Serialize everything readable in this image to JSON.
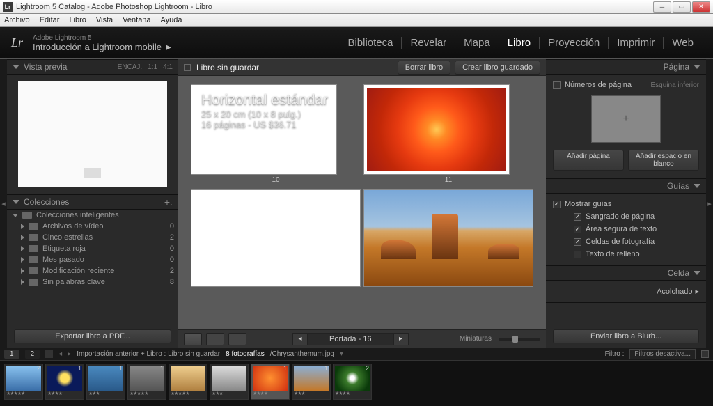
{
  "titlebar": {
    "text": "Lightroom 5 Catalog - Adobe Photoshop Lightroom - Libro",
    "icon": "Lr"
  },
  "menubar": [
    "Archivo",
    "Editar",
    "Libro",
    "Vista",
    "Ventana",
    "Ayuda"
  ],
  "header": {
    "product": "Adobe Lightroom 5",
    "subtitle": "Introducción a Lightroom mobile  ►",
    "modules": [
      "Biblioteca",
      "Revelar",
      "Mapa",
      "Libro",
      "Proyección",
      "Imprimir",
      "Web"
    ],
    "active_module": "Libro"
  },
  "left": {
    "preview": {
      "title": "Vista previa",
      "extras": [
        "ENCAJ.",
        "1:1",
        "4:1"
      ]
    },
    "collections": {
      "title": "Colecciones",
      "group": "Colecciones inteligentes",
      "items": [
        {
          "name": "Archivos de vídeo",
          "count": 0
        },
        {
          "name": "Cinco estrellas",
          "count": 2
        },
        {
          "name": "Etiqueta roja",
          "count": 0
        },
        {
          "name": "Mes pasado",
          "count": 0
        },
        {
          "name": "Modificación reciente",
          "count": 2
        },
        {
          "name": "Sin palabras clave",
          "count": 8
        }
      ]
    },
    "export_btn": "Exportar libro a PDF..."
  },
  "center": {
    "title": "Libro sin guardar",
    "btn_clear": "Borrar libro",
    "btn_create": "Crear libro guardado",
    "overlay": {
      "title": "Horizontal estándar",
      "size": "25 x 20 cm (10 x 8 pulg.)",
      "info": "16 páginas - US $36.71"
    },
    "page_nums": [
      "10",
      "11"
    ],
    "pager": "Portada - 16",
    "thumbs_label": "Miniaturas"
  },
  "right": {
    "pagina": {
      "title": "Página",
      "pagenums": "Números de página",
      "corner": "Esquina inferior",
      "add_page": "Añadir página",
      "add_blank": "Añadir espacio en blanco"
    },
    "guias": {
      "title": "Guías",
      "show": "Mostrar guías",
      "items": [
        "Sangrado de página",
        "Área segura de texto",
        "Celdas de fotografía",
        "Texto de relleno"
      ],
      "checked": [
        true,
        true,
        true,
        false
      ]
    },
    "celda": {
      "title": "Celda",
      "padding": "Acolchado"
    },
    "send_btn": "Enviar libro a Blurb..."
  },
  "filmstrip": {
    "path": "Importación anterior  +  Libro : Libro sin guardar",
    "count": "8 fotografías",
    "file": "/Chrysanthemum.jpg",
    "filter_label": "Filtro :",
    "filter_value": "Filtros desactiva...",
    "tabs": [
      "1",
      "2"
    ],
    "thumbs": [
      {
        "badge": "2",
        "bg": "linear-gradient(#8ac3f0,#3a6ea8)",
        "stars": "★★★★★"
      },
      {
        "badge": "1",
        "bg": "radial-gradient(circle,#ffe060 20%,#0a1a5a 40%)",
        "stars": "★★★★"
      },
      {
        "badge": "1",
        "bg": "linear-gradient(#4a8ac0,#2a5a8a)",
        "stars": "★★★"
      },
      {
        "badge": "1",
        "bg": "linear-gradient(#888,#555)",
        "stars": "★★★★★"
      },
      {
        "badge": "1",
        "bg": "linear-gradient(#f0d090,#b08040)",
        "stars": "★★★★★"
      },
      {
        "badge": "1",
        "bg": "linear-gradient(#ddd,#888)",
        "stars": "★★★"
      },
      {
        "badge": "1",
        "bg": "radial-gradient(circle,#ff9030,#d03010)",
        "stars": "★★★★",
        "sel": true
      },
      {
        "badge": "1",
        "bg": "linear-gradient(#8ab0d8,#c47828)",
        "stars": "★★★"
      },
      {
        "badge": "2",
        "bg": "radial-gradient(circle,#fff 10%,#3a7a2a 30%,#0a3a0a 80%)",
        "stars": "★★★★"
      }
    ]
  }
}
